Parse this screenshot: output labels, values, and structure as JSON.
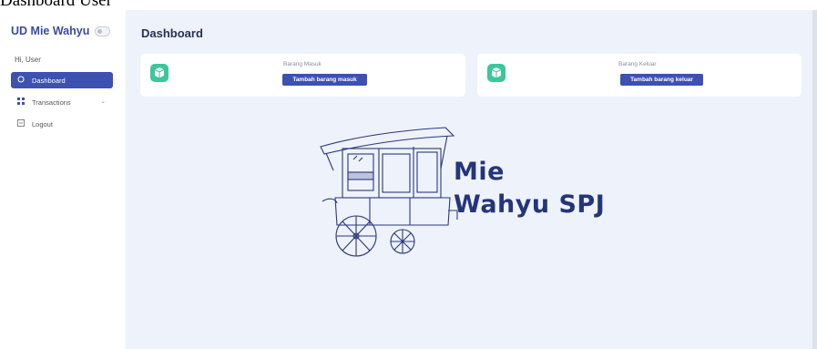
{
  "caption": "Dashboard User",
  "sidebar": {
    "brand": "UD Mie Wahyu",
    "greeting": "Hi, User",
    "items": [
      {
        "label": "Dashboard",
        "icon": "circle-icon",
        "active": true
      },
      {
        "label": "Transactions",
        "icon": "grid-icon",
        "expandable": true
      },
      {
        "label": "Logout",
        "icon": "logout-icon"
      }
    ]
  },
  "main": {
    "title": "Dashboard",
    "cards": [
      {
        "label": "Barang Masuk",
        "button": "Tambah barang masuk",
        "icon": "box-icon"
      },
      {
        "label": "Barang Keluar",
        "button": "Tambah barang keluar",
        "icon": "box-icon"
      }
    ],
    "logo": {
      "line1": "Mie",
      "line2": "Wahyu SPJ"
    }
  },
  "colors": {
    "accent": "#3d51b1",
    "icon_green": "#3cc79a",
    "main_bg": "#eef2fb",
    "logo_ink": "#24357a"
  }
}
